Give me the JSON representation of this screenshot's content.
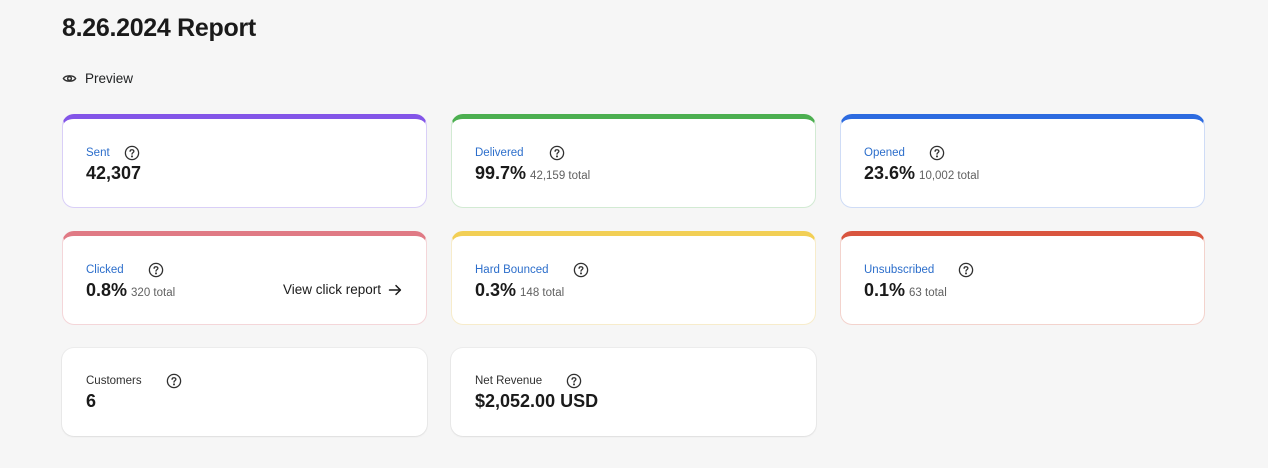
{
  "header": {
    "title": "8.26.2024 Report",
    "preview_label": "Preview"
  },
  "stats": {
    "sent": {
      "label": "Sent",
      "value": "42,307",
      "accent": "#8355e8",
      "accent_soft": "#d9cff7"
    },
    "delivered": {
      "label": "Delivered",
      "value": "99.7%",
      "sub": "42,159 total",
      "accent": "#4caf50",
      "accent_soft": "#d2ead3"
    },
    "opened": {
      "label": "Opened",
      "value": "23.6%",
      "sub": "10,002 total",
      "accent": "#2d6be0",
      "accent_soft": "#cfdcf6"
    },
    "clicked": {
      "label": "Clicked",
      "value": "0.8%",
      "sub": "320 total",
      "link_label": "View click report",
      "accent": "#e07a85",
      "accent_soft": "#f4d6d9"
    },
    "hard_bounced": {
      "label": "Hard Bounced",
      "value": "0.3%",
      "sub": "148 total",
      "accent": "#f2cf55",
      "accent_soft": "#f7eccb"
    },
    "unsubscribed": {
      "label": "Unsubscribed",
      "value": "0.1%",
      "sub": "63 total",
      "accent": "#d9553f",
      "accent_soft": "#f3d3cd"
    },
    "customers": {
      "label": "Customers",
      "value": "6"
    },
    "net_revenue": {
      "label": "Net Revenue",
      "value": "$2,052.00 USD"
    }
  },
  "icons": {
    "preview": "eye-icon",
    "help": "question-circle-icon",
    "link_arrow": "arrow-right-icon"
  }
}
